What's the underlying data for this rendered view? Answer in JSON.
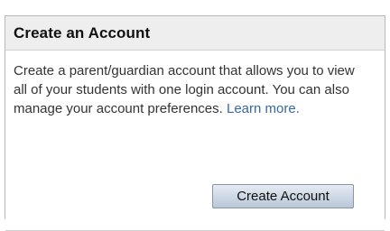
{
  "panel": {
    "title": "Create an Account",
    "description": "Create a parent/guardian account that allows you to view all of your students with one login account. You can also manage your account preferences.",
    "learn_more_label": "Learn more.",
    "create_button_label": "Create Account"
  },
  "colors": {
    "header_background": "#eeeeee",
    "link": "#3568a8",
    "button_gradient_top": "#e5ebf3",
    "button_gradient_bottom": "#b9c7d8"
  }
}
